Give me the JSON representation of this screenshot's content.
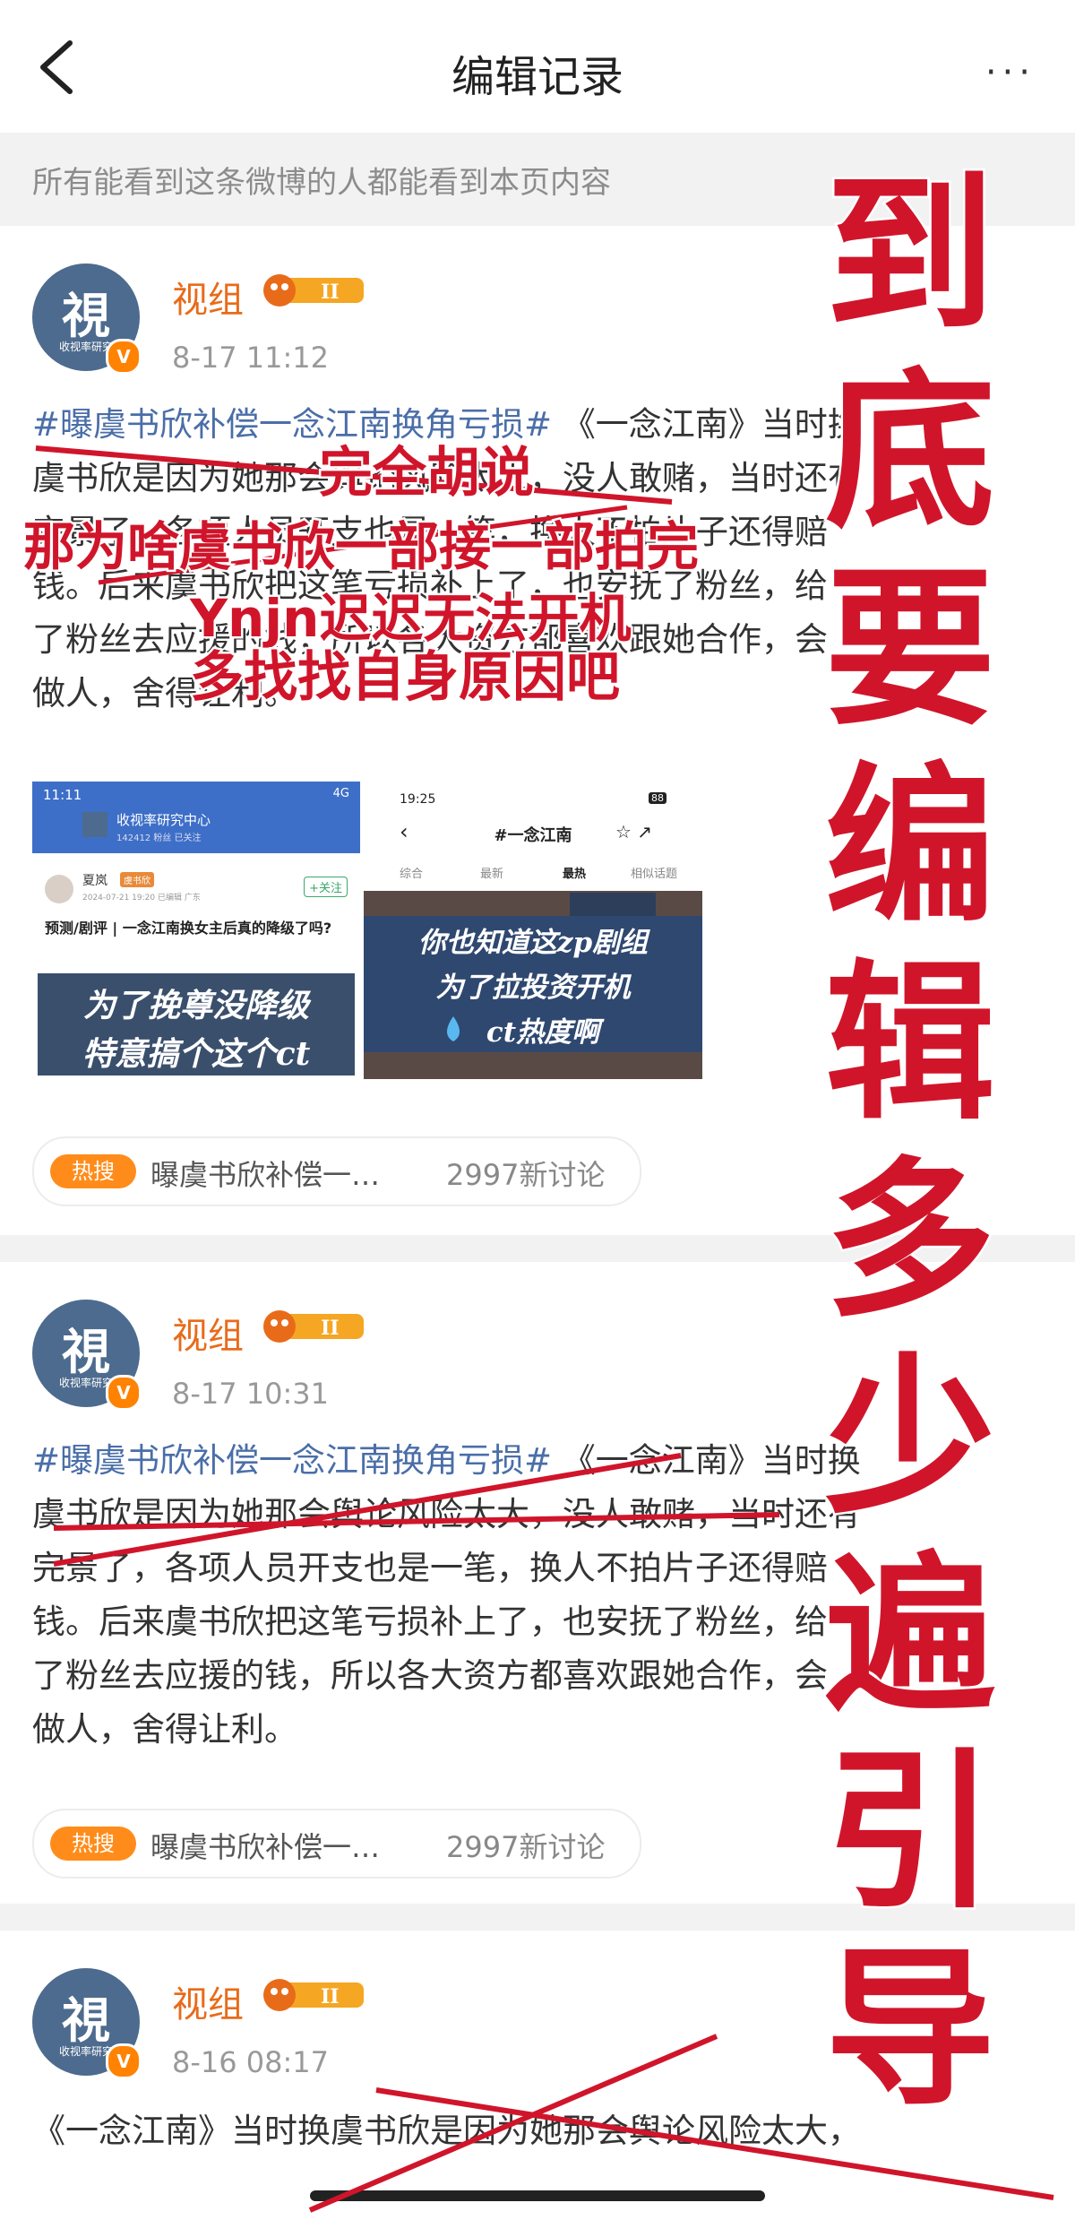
{
  "nav": {
    "title": "编辑记录",
    "more": "···"
  },
  "notice": "所有能看到这条微博的人都能看到本页内容",
  "posts": [
    {
      "user": "视组",
      "time": "8-17 11:12",
      "topic": "#曝虞书欣补偿一念江南换角亏损#",
      "lines": [
        "《一念江南》当时换",
        "虞书欣是因为她那会舆论风险太大，没人敢赌，当时还有",
        "完景了，各项人员开支也是一笔，换人不拍片子还得赔",
        "钱。后来虞书欣把这笔亏损补上了，也安抚了粉丝，给",
        "了粉丝去应援的钱，所以各大资方都喜欢跟她合作，会",
        "做人，舍得让利。"
      ],
      "trending": {
        "badge": "热搜",
        "text": "曝虞书欣补偿一…",
        "count": "2997新讨论"
      },
      "screenshots": {
        "left": {
          "time": "11:11",
          "status": "4G",
          "account": "收视率研究中心",
          "account_sub": "142412 粉丝 已关注",
          "commenter": "夏岚",
          "commenter_badge": "虞书欣",
          "follow": "+关注",
          "meta": "2024-07-21 19:20 已编辑 广东",
          "headline": "预测/剧评 | 一念江南换女主后真的降级了吗?",
          "caption_lines": [
            "为了挽尊没降级",
            "特意搞个这个ct"
          ]
        },
        "right": {
          "time": "19:25",
          "status": "88",
          "title": "#一念江南",
          "tabs": [
            "综合",
            "最新",
            "最热",
            "相似话题"
          ],
          "caption_lines": [
            "你也知道这zp剧组",
            "为了拉投资开机",
            "ct热度啊"
          ]
        }
      }
    },
    {
      "user": "视组",
      "time": "8-17 10:31",
      "topic": "#曝虞书欣补偿一念江南换角亏损#",
      "lines": [
        "《一念江南》当时换",
        "虞书欣是因为她那会舆论风险太大，没人敢赌，当时还有",
        "完景了，各项人员开支也是一笔，换人不拍片子还得赔",
        "钱。后来虞书欣把这笔亏损补上了，也安抚了粉丝，给",
        "了粉丝去应援的钱，所以各大资方都喜欢跟她合作，会",
        "做人，舍得让利。"
      ],
      "trending": {
        "badge": "热搜",
        "text": "曝虞书欣补偿一…",
        "count": "2997新讨论"
      }
    },
    {
      "user": "视组",
      "time": "8-16 08:17",
      "lines": [
        "《一念江南》当时换虞书欣是因为她那会舆论风险太大，"
      ]
    }
  ],
  "avatar": {
    "char": "視",
    "sub": "收视率研究"
  },
  "annotations": {
    "red_lines": [
      "完全胡说",
      "那为啥虞书欣一部接一部拍完",
      "Ynjn迟迟无法开机",
      "多找找自身原因吧"
    ],
    "vertical_text": [
      "到",
      "底",
      "要",
      "编",
      "辑",
      "多",
      "少",
      "遍",
      "引",
      "导"
    ]
  },
  "colors": {
    "accent": "#ff8200",
    "link": "#4a6ea8",
    "red": "#d0152b",
    "username": "#e86b1a"
  }
}
